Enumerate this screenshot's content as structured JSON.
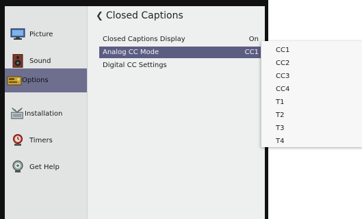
{
  "sidebar": {
    "items": [
      {
        "label": "Picture",
        "icon": "monitor-icon"
      },
      {
        "label": "Sound",
        "icon": "speaker-icon"
      },
      {
        "label": "Options",
        "icon": "options-icon",
        "active": true
      },
      {
        "label": "Installation",
        "icon": "antenna-icon"
      },
      {
        "label": "Timers",
        "icon": "timer-icon"
      },
      {
        "label": "Get Help",
        "icon": "help-icon"
      }
    ]
  },
  "main": {
    "title": "Closed Captions",
    "rows": [
      {
        "label": "Closed Captions Display",
        "value": "On"
      },
      {
        "label": "Analog CC Mode",
        "value": "CC1"
      },
      {
        "label": "Digital CC Settings",
        "value": ""
      }
    ]
  },
  "dropdown": {
    "options": [
      "CC1",
      "CC2",
      "CC3",
      "CC4",
      "T1",
      "T2",
      "T3",
      "T4"
    ]
  },
  "colors": {
    "selection": "#5b5d83",
    "sidebar_active": "#6e6f8f",
    "frame": "#111111"
  }
}
